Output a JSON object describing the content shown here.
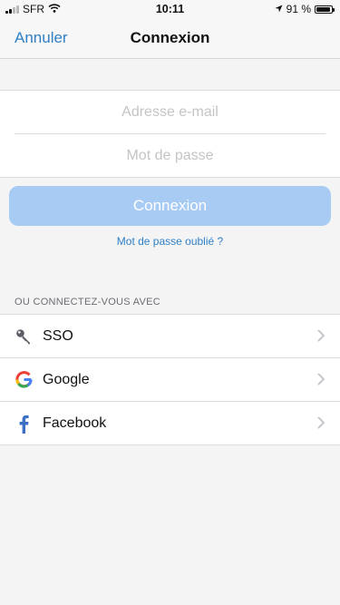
{
  "status_bar": {
    "carrier": "SFR",
    "time": "10:11",
    "battery_percent": "91 %",
    "battery_level": 0.91,
    "signal_bars": 2
  },
  "nav": {
    "cancel_label": "Annuler",
    "title": "Connexion"
  },
  "form": {
    "email_placeholder": "Adresse e-mail",
    "email_value": "",
    "password_placeholder": "Mot de passe",
    "password_value": ""
  },
  "actions": {
    "login_label": "Connexion",
    "login_color": "#a8cbf3",
    "forgot_label": "Mot de passe oublié ?"
  },
  "section": {
    "header": "OU CONNECTEZ-VOUS AVEC"
  },
  "providers": [
    {
      "label": "SSO",
      "icon": "key-icon"
    },
    {
      "label": "Google",
      "icon": "google-icon"
    },
    {
      "label": "Facebook",
      "icon": "facebook-icon"
    }
  ],
  "colors": {
    "accent": "#2f80c6",
    "background": "#f4f4f5"
  }
}
